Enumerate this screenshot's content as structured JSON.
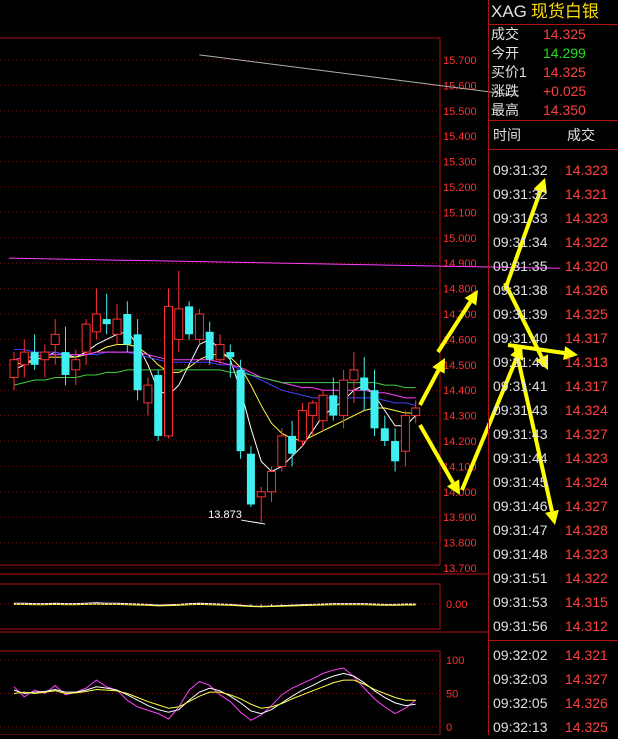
{
  "quote": {
    "symbol": "XAG",
    "name": "现货白银",
    "rows": [
      {
        "label": "成交",
        "value": "14.325",
        "color": "red"
      },
      {
        "label": "今开",
        "value": "14.299",
        "color": "green"
      },
      {
        "label": "买价1",
        "value": "14.325",
        "color": "red"
      },
      {
        "label": "涨跌",
        "value": "+0.025",
        "color": "red"
      },
      {
        "label": "最高",
        "value": "14.350",
        "color": "red"
      }
    ],
    "columns": {
      "time": "时间",
      "price": "成交"
    }
  },
  "ticks": [
    {
      "time": "09:31:32",
      "price": "14.323"
    },
    {
      "time": "09:31:32",
      "price": "14.321"
    },
    {
      "time": "09:31:33",
      "price": "14.323"
    },
    {
      "time": "09:31:34",
      "price": "14.322"
    },
    {
      "time": "09:31:35",
      "price": "14.320"
    },
    {
      "time": "09:31:38",
      "price": "14.326"
    },
    {
      "time": "09:31:39",
      "price": "14.325"
    },
    {
      "time": "09:31:40",
      "price": "14.317"
    },
    {
      "time": "09:31:40",
      "price": "14.313"
    },
    {
      "time": "09:31:41",
      "price": "14.317"
    },
    {
      "time": "09:31:43",
      "price": "14.324"
    },
    {
      "time": "09:31:43",
      "price": "14.327"
    },
    {
      "time": "09:31:44",
      "price": "14.323"
    },
    {
      "time": "09:31:45",
      "price": "14.324"
    },
    {
      "time": "09:31:46",
      "price": "14.327"
    },
    {
      "time": "09:31:47",
      "price": "14.328"
    },
    {
      "time": "09:31:48",
      "price": "14.323"
    },
    {
      "time": "09:31:51",
      "price": "14.322"
    },
    {
      "time": "09:31:53",
      "price": "14.315"
    },
    {
      "time": "09:31:56",
      "price": "14.312"
    },
    {
      "time": "09:32:02",
      "price": "14.321"
    },
    {
      "time": "09:32:03",
      "price": "14.327"
    },
    {
      "time": "09:32:05",
      "price": "14.326"
    },
    {
      "time": "09:32:13",
      "price": "14.325"
    }
  ],
  "chart_data": {
    "type": "candlestick",
    "ylim": [
      13.7,
      15.7
    ],
    "price_ticks": [
      "15.700",
      "15.600",
      "15.500",
      "15.400",
      "15.300",
      "15.200",
      "15.100",
      "15.000",
      "14.900",
      "14.800",
      "14.700",
      "14.600",
      "14.500",
      "14.400",
      "14.300",
      "14.200",
      "14.100",
      "14.000",
      "13.900",
      "13.800",
      "13.700"
    ],
    "low_annotation": "13.873",
    "candles": [
      {
        "o": 14.45,
        "h": 14.55,
        "l": 14.4,
        "c": 14.52
      },
      {
        "o": 14.5,
        "h": 14.6,
        "l": 14.45,
        "c": 14.55
      },
      {
        "o": 14.55,
        "h": 14.62,
        "l": 14.48,
        "c": 14.5
      },
      {
        "o": 14.52,
        "h": 14.58,
        "l": 14.45,
        "c": 14.55
      },
      {
        "o": 14.58,
        "h": 14.68,
        "l": 14.5,
        "c": 14.62
      },
      {
        "o": 14.55,
        "h": 14.65,
        "l": 14.42,
        "c": 14.46
      },
      {
        "o": 14.48,
        "h": 14.56,
        "l": 14.42,
        "c": 14.52
      },
      {
        "o": 14.55,
        "h": 14.68,
        "l": 14.5,
        "c": 14.66
      },
      {
        "o": 14.63,
        "h": 14.8,
        "l": 14.6,
        "c": 14.7
      },
      {
        "o": 14.68,
        "h": 14.78,
        "l": 14.62,
        "c": 14.66
      },
      {
        "o": 14.62,
        "h": 14.74,
        "l": 14.58,
        "c": 14.68
      },
      {
        "o": 14.7,
        "h": 14.75,
        "l": 14.55,
        "c": 14.58
      },
      {
        "o": 14.62,
        "h": 14.68,
        "l": 14.36,
        "c": 14.4
      },
      {
        "o": 14.35,
        "h": 14.45,
        "l": 14.3,
        "c": 14.42
      },
      {
        "o": 14.46,
        "h": 14.48,
        "l": 14.2,
        "c": 14.22
      },
      {
        "o": 14.22,
        "h": 14.8,
        "l": 14.21,
        "c": 14.73
      },
      {
        "o": 14.6,
        "h": 14.87,
        "l": 14.55,
        "c": 14.72
      },
      {
        "o": 14.73,
        "h": 14.75,
        "l": 14.6,
        "c": 14.62
      },
      {
        "o": 14.6,
        "h": 14.72,
        "l": 14.58,
        "c": 14.7
      },
      {
        "o": 14.63,
        "h": 14.67,
        "l": 14.5,
        "c": 14.52
      },
      {
        "o": 14.52,
        "h": 14.62,
        "l": 14.5,
        "c": 14.58
      },
      {
        "o": 14.55,
        "h": 14.58,
        "l": 14.45,
        "c": 14.53
      },
      {
        "o": 14.48,
        "h": 14.52,
        "l": 14.13,
        "c": 14.16
      },
      {
        "o": 14.15,
        "h": 14.18,
        "l": 13.94,
        "c": 13.95
      },
      {
        "o": 13.98,
        "h": 14.02,
        "l": 13.88,
        "c": 14.0
      },
      {
        "o": 14.0,
        "h": 14.1,
        "l": 13.96,
        "c": 14.08
      },
      {
        "o": 14.1,
        "h": 14.25,
        "l": 14.08,
        "c": 14.22
      },
      {
        "o": 14.22,
        "h": 14.28,
        "l": 14.1,
        "c": 14.15
      },
      {
        "o": 14.2,
        "h": 14.35,
        "l": 14.18,
        "c": 14.32
      },
      {
        "o": 14.3,
        "h": 14.36,
        "l": 14.22,
        "c": 14.35
      },
      {
        "o": 14.28,
        "h": 14.4,
        "l": 14.24,
        "c": 14.38
      },
      {
        "o": 14.38,
        "h": 14.45,
        "l": 14.28,
        "c": 14.3
      },
      {
        "o": 14.3,
        "h": 14.48,
        "l": 14.25,
        "c": 14.44
      },
      {
        "o": 14.44,
        "h": 14.55,
        "l": 14.35,
        "c": 14.48
      },
      {
        "o": 14.45,
        "h": 14.53,
        "l": 14.32,
        "c": 14.4
      },
      {
        "o": 14.4,
        "h": 14.48,
        "l": 14.22,
        "c": 14.25
      },
      {
        "o": 14.25,
        "h": 14.3,
        "l": 14.18,
        "c": 14.2
      },
      {
        "o": 14.2,
        "h": 14.25,
        "l": 14.08,
        "c": 14.12
      },
      {
        "o": 14.16,
        "h": 14.32,
        "l": 14.1,
        "c": 14.3
      },
      {
        "o": 14.3,
        "h": 14.36,
        "l": 14.27,
        "c": 14.33
      }
    ],
    "ma_series": [
      {
        "color": "#ffffff",
        "values": [
          14.48,
          14.5,
          14.52,
          14.53,
          14.55,
          14.54,
          14.53,
          14.55,
          14.58,
          14.6,
          14.62,
          14.63,
          14.58,
          14.5,
          14.4,
          14.38,
          14.42,
          14.5,
          14.58,
          14.6,
          14.56,
          14.52,
          14.4,
          14.25,
          14.12,
          14.08,
          14.1,
          14.14,
          14.18,
          14.24,
          14.3,
          14.33,
          14.36,
          14.4,
          14.42,
          14.38,
          14.32,
          14.26,
          14.26,
          14.3
        ]
      },
      {
        "color": "#ffff40",
        "values": [
          14.5,
          14.51,
          14.52,
          14.53,
          14.53,
          14.53,
          14.53,
          14.54,
          14.55,
          14.57,
          14.58,
          14.58,
          14.57,
          14.54,
          14.5,
          14.47,
          14.47,
          14.49,
          14.52,
          14.54,
          14.54,
          14.53,
          14.49,
          14.42,
          14.34,
          14.27,
          14.23,
          14.21,
          14.2,
          14.22,
          14.24,
          14.26,
          14.28,
          14.3,
          14.32,
          14.33,
          14.33,
          14.32,
          14.31,
          14.31
        ]
      },
      {
        "color": "#4040ff",
        "values": [
          14.56,
          14.56,
          14.55,
          14.55,
          14.55,
          14.54,
          14.54,
          14.54,
          14.54,
          14.55,
          14.55,
          14.55,
          14.54,
          14.53,
          14.52,
          14.51,
          14.51,
          14.51,
          14.51,
          14.51,
          14.5,
          14.5,
          14.48,
          14.46,
          14.44,
          14.42,
          14.4,
          14.39,
          14.38,
          14.37,
          14.37,
          14.37,
          14.37,
          14.37,
          14.37,
          14.37,
          14.36,
          14.35,
          14.35,
          14.34
        ]
      },
      {
        "color": "#ff40ff",
        "values": [
          14.52,
          14.53,
          14.53,
          14.54,
          14.54,
          14.54,
          14.54,
          14.54,
          14.55,
          14.55,
          14.55,
          14.55,
          14.55,
          14.54,
          14.53,
          14.52,
          14.52,
          14.52,
          14.52,
          14.52,
          14.51,
          14.5,
          14.49,
          14.47,
          14.45,
          14.44,
          14.43,
          14.42,
          14.41,
          14.41,
          14.4,
          14.4,
          14.4,
          14.4,
          14.4,
          14.39,
          14.39,
          14.38,
          14.37,
          14.37
        ]
      },
      {
        "color": "#40d040",
        "values": [
          14.42,
          14.43,
          14.44,
          14.44,
          14.45,
          14.45,
          14.45,
          14.46,
          14.46,
          14.47,
          14.47,
          14.48,
          14.48,
          14.48,
          14.48,
          14.48,
          14.48,
          14.48,
          14.48,
          14.48,
          14.48,
          14.47,
          14.47,
          14.46,
          14.45,
          14.44,
          14.43,
          14.43,
          14.43,
          14.43,
          14.43,
          14.43,
          14.43,
          14.43,
          14.43,
          14.43,
          14.42,
          14.42,
          14.41,
          14.41
        ]
      }
    ],
    "trend_lines": [
      {
        "color": "#b0b0b0",
        "from": {
          "i": 18,
          "v": 15.72
        },
        "to": {
          "i": 49,
          "v": 15.56
        }
      },
      {
        "color": "#ff40ff",
        "from": {
          "i": -0.5,
          "v": 14.92
        },
        "to": {
          "i": 53,
          "v": 14.88
        }
      }
    ],
    "osc1_label": "0.00",
    "osc2_labels": [
      "100",
      "50",
      "0"
    ],
    "osc1_values": [
      0.02,
      0.02,
      0.01,
      0.01,
      0.02,
      0.01,
      0.01,
      0.02,
      0.03,
      0.02,
      0.02,
      0.01,
      0.0,
      -0.01,
      -0.03,
      -0.02,
      -0.01,
      0.01,
      0.02,
      0.01,
      0.0,
      -0.01,
      -0.03,
      -0.05,
      -0.06,
      -0.05,
      -0.04,
      -0.03,
      -0.02,
      -0.01,
      0.0,
      0.01,
      0.01,
      0.01,
      0.01,
      0.0,
      -0.01,
      -0.01,
      0.0,
      0.0
    ],
    "osc2_k": [
      60,
      45,
      55,
      50,
      62,
      48,
      52,
      58,
      70,
      60,
      55,
      40,
      30,
      25,
      20,
      12,
      30,
      55,
      68,
      62,
      48,
      38,
      22,
      10,
      18,
      32,
      48,
      58,
      65,
      72,
      80,
      85,
      88,
      75,
      58,
      42,
      30,
      20,
      28,
      40
    ],
    "osc2_d": [
      55,
      50,
      52,
      53,
      56,
      52,
      52,
      55,
      60,
      58,
      55,
      48,
      40,
      32,
      26,
      22,
      26,
      40,
      52,
      58,
      54,
      46,
      36,
      24,
      20,
      26,
      36,
      46,
      55,
      62,
      70,
      76,
      80,
      76,
      66,
      54,
      44,
      36,
      32,
      34
    ],
    "osc2_j": [
      50,
      52,
      50,
      52,
      54,
      50,
      51,
      53,
      56,
      55,
      54,
      50,
      44,
      38,
      33,
      28,
      30,
      38,
      46,
      52,
      52,
      48,
      42,
      34,
      28,
      30,
      35,
      42,
      48,
      54,
      60,
      66,
      70,
      70,
      64,
      56,
      50,
      44,
      40,
      40
    ],
    "arrows": [
      {
        "from": [
          420,
          405
        ],
        "to": [
          445,
          358
        ]
      },
      {
        "from": [
          438,
          352
        ],
        "to": [
          478,
          290
        ]
      },
      {
        "from": [
          505,
          290
        ],
        "to": [
          545,
          178
        ]
      },
      {
        "from": [
          505,
          283
        ],
        "to": [
          548,
          370
        ]
      },
      {
        "from": [
          420,
          425
        ],
        "to": [
          460,
          495
        ]
      },
      {
        "from": [
          462,
          490
        ],
        "to": [
          522,
          345
        ]
      },
      {
        "from": [
          515,
          345
        ],
        "to": [
          555,
          525
        ]
      },
      {
        "from": [
          508,
          345
        ],
        "to": [
          578,
          355
        ]
      }
    ]
  }
}
